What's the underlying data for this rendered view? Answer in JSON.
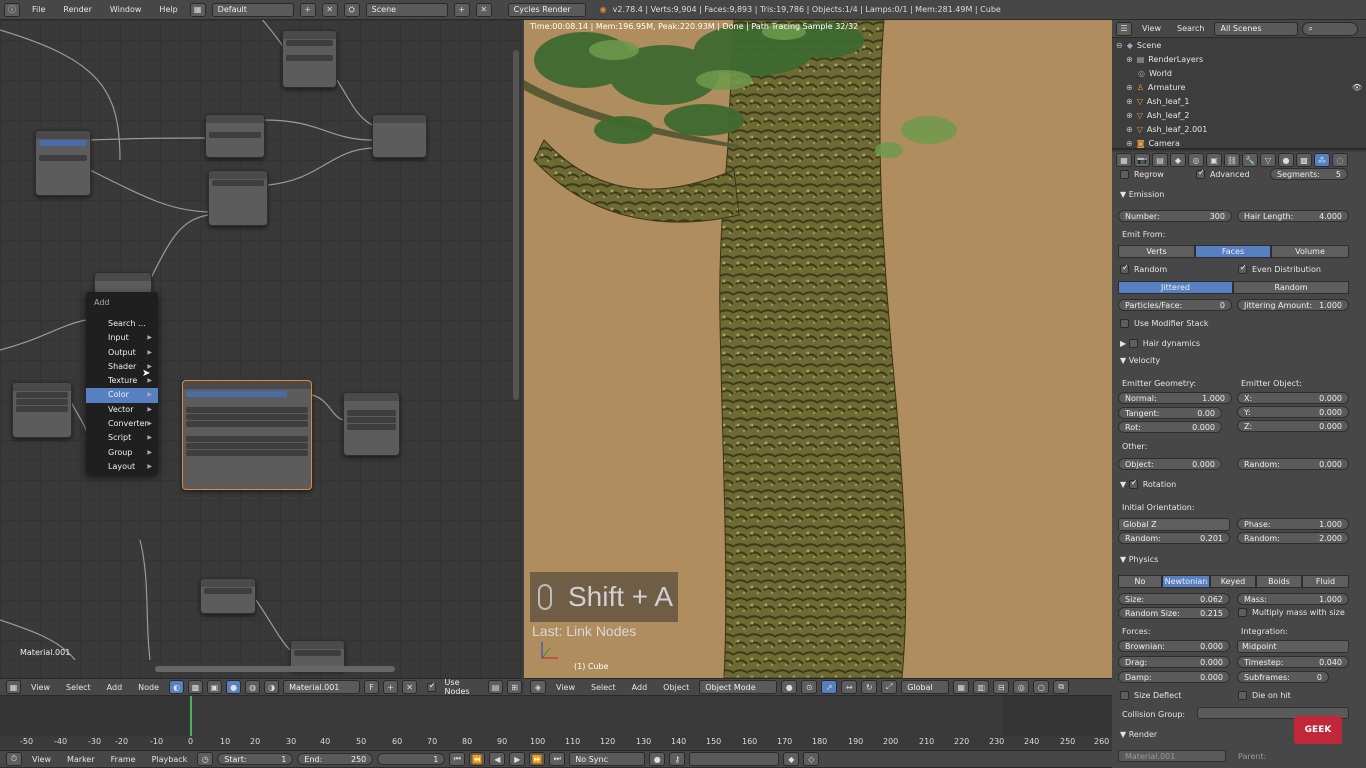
{
  "topbar": {
    "menus": [
      "File",
      "Render",
      "Window",
      "Help"
    ],
    "layout": "Default",
    "scene": "Scene",
    "engine": "Cycles Render",
    "stats": "v2.78.4 | Verts:9,904 | Faces:9,893 | Tris:19,786 | Objects:1/4 | Lamps:0/1 | Mem:281.49M | Cube"
  },
  "node_editor": {
    "material_label": "Material.001",
    "header": {
      "menus": [
        "View",
        "Select",
        "Add",
        "Node"
      ],
      "material": "Material.001",
      "material_user": "F",
      "use_nodes": "Use Nodes"
    }
  },
  "add_menu": {
    "title": "Add",
    "items": [
      "Search ...",
      "Input",
      "Output",
      "Shader",
      "Texture",
      "Color",
      "Vector",
      "Converter",
      "Script",
      "Group",
      "Layout"
    ],
    "selected": "Color"
  },
  "viewport": {
    "info": "Time:00:08.14 | Mem:196.95M, Peak:220.93M | Done | Path Tracing Sample 32/32",
    "shortcut": "Shift + A",
    "last_op": "Last: Link Nodes",
    "object_label": "(1) Cube",
    "header": {
      "menus": [
        "View",
        "Select",
        "Add",
        "Object"
      ],
      "mode": "Object Mode",
      "orientation": "Global"
    }
  },
  "outliner": {
    "menus": [
      "View",
      "Search"
    ],
    "filter": "All Scenes",
    "rows": [
      "Scene",
      "RenderLayers",
      "World",
      "Armature",
      "Ash_leaf_1",
      "Ash_leaf_2",
      "Ash_leaf_2.001",
      "Camera"
    ]
  },
  "properties": {
    "regrow": "Regrow",
    "advanced": "Advanced",
    "segments": {
      "label": "Segments:",
      "value": "5"
    },
    "emission": {
      "title": "Emission",
      "number": {
        "label": "Number:",
        "value": "300"
      },
      "hair_length": {
        "label": "Hair Length:",
        "value": "4.000"
      },
      "emit_from": "Emit From:",
      "emit_options": [
        "Verts",
        "Faces",
        "Volume"
      ],
      "random": "Random",
      "even_distribution": "Even Distribution",
      "dist_options": [
        "Jittered",
        "Random"
      ],
      "particles_face": {
        "label": "Particles/Face:",
        "value": "0"
      },
      "jittering": {
        "label": "Jittering Amount:",
        "value": "1.000"
      },
      "use_modifier_stack": "Use Modifier Stack"
    },
    "hair_dynamics": "Hair dynamics",
    "velocity": {
      "title": "Velocity",
      "emitter_geometry": "Emitter Geometry:",
      "emitter_object": "Emitter Object:",
      "normal": {
        "label": "Normal:",
        "value": "1.000"
      },
      "tangent": {
        "label": "Tangent:",
        "value": "0.00"
      },
      "rot": {
        "label": "Rot:",
        "value": "0.000"
      },
      "x": {
        "label": "X:",
        "value": "0.000"
      },
      "y": {
        "label": "Y:",
        "value": "0.000"
      },
      "z": {
        "label": "Z:",
        "value": "0.000"
      },
      "other": "Other:",
      "object": {
        "label": "Object:",
        "value": "0.000"
      },
      "random": {
        "label": "Random:",
        "value": "0.000"
      }
    },
    "rotation": {
      "title": "Rotation",
      "initial_orientation": "Initial Orientation:",
      "orientation_value": "Global Z",
      "phase": {
        "label": "Phase:",
        "value": "1.000"
      },
      "random1": {
        "label": "Random:",
        "value": "0.201"
      },
      "random2": {
        "label": "Random:",
        "value": "2.000"
      }
    },
    "physics": {
      "title": "Physics",
      "options": [
        "No",
        "Newtonian",
        "Keyed",
        "Boids",
        "Fluid"
      ],
      "size": {
        "label": "Size:",
        "value": "0.062"
      },
      "mass": {
        "label": "Mass:",
        "value": "1.000"
      },
      "random_size": {
        "label": "Random Size:",
        "value": "0.215"
      },
      "multiply_mass": "Multiply mass with size",
      "forces": "Forces:",
      "integration": "Integration:",
      "brownian": {
        "label": "Brownian:",
        "value": "0.000"
      },
      "integration_value": "Midpoint",
      "drag": {
        "label": "Drag:",
        "value": "0.000"
      },
      "timestep": {
        "label": "Timestep:",
        "value": "0.040"
      },
      "damp": {
        "label": "Damp:",
        "value": "0.000"
      },
      "subframes": {
        "label": "Subframes:",
        "value": "0"
      },
      "size_deflect": "Size Deflect",
      "die_on_hit": "Die on hit",
      "collision_group": "Collision Group:"
    },
    "render": {
      "title": "Render",
      "material": "Material.001",
      "parent": "Parent:"
    }
  },
  "timeline": {
    "ticks": [
      "-50",
      "-40",
      "-30",
      "-20",
      "-10",
      "0",
      "10",
      "20",
      "30",
      "40",
      "50",
      "60",
      "70",
      "80",
      "90",
      "100",
      "110",
      "120",
      "130",
      "140",
      "150",
      "160",
      "170",
      "180",
      "190",
      "200",
      "210",
      "220",
      "230",
      "240",
      "250",
      "260",
      "270",
      "280"
    ],
    "menus": [
      "View",
      "Marker",
      "Frame",
      "Playback"
    ],
    "start": {
      "label": "Start:",
      "value": "1"
    },
    "end": {
      "label": "End:",
      "value": "250"
    },
    "current": "1",
    "sync": "No Sync"
  },
  "watermark": "GEEK",
  "colors": {
    "accent": "#5680c2",
    "bg": "#3d3d3d",
    "node_sel": "#e08a3c"
  }
}
